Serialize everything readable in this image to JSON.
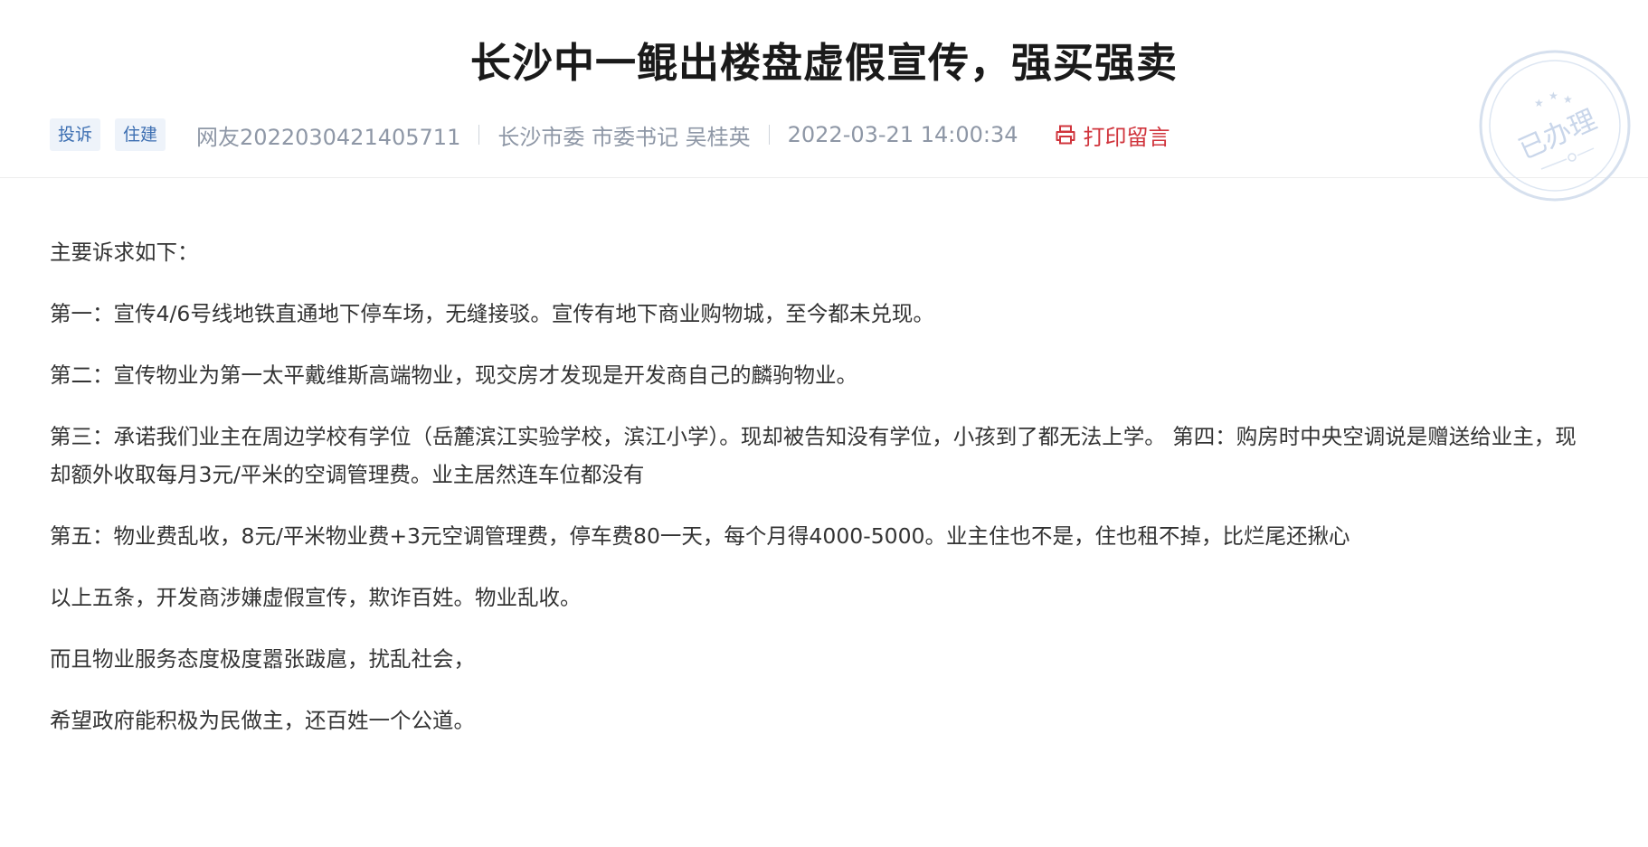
{
  "title": "长沙中一鲲出楼盘虚假宣传，强买强卖",
  "meta": {
    "tags": [
      "投诉",
      "住建"
    ],
    "user": "网友2022030421405711",
    "recipient": "长沙市委 市委书记 吴桂英",
    "datetime": "2022-03-21 14:00:34",
    "print_label": "打印留言"
  },
  "stamp": {
    "text": "已办理",
    "icon": "stamp-icon",
    "color": "#c9d6ea"
  },
  "colors": {
    "tag_text": "#3d6fb2",
    "tag_bg": "#eef3fa",
    "print": "#d0343c",
    "meta": "#8e97a6"
  },
  "content": {
    "paragraphs": [
      "主要诉求如下：",
      "第一：宣传4/6号线地铁直通地下停车场，无缝接驳。宣传有地下商业购物城，至今都未兑现。",
      "第二：宣传物业为第一太平戴维斯高端物业，现交房才发现是开发商自己的麟驹物业。",
      "第三：承诺我们业主在周边学校有学位（岳麓滨江实验学校，滨江小学）。现却被告知没有学位，小孩到了都无法上学。  第四：购房时中央空调说是赠送给业主，现却额外收取每月3元/平米的空调管理费。业主居然连车位都没有",
      "第五：物业费乱收，8元/平米物业费+3元空调管理费，停车费80一天，每个月得4000-5000。业主住也不是，住也租不掉，比烂尾还揪心",
      "以上五条，开发商涉嫌虚假宣传，欺诈百姓。物业乱收。",
      "而且物业服务态度极度嚣张跋扈，扰乱社会，",
      "希望政府能积极为民做主，还百姓一个公道。"
    ]
  }
}
